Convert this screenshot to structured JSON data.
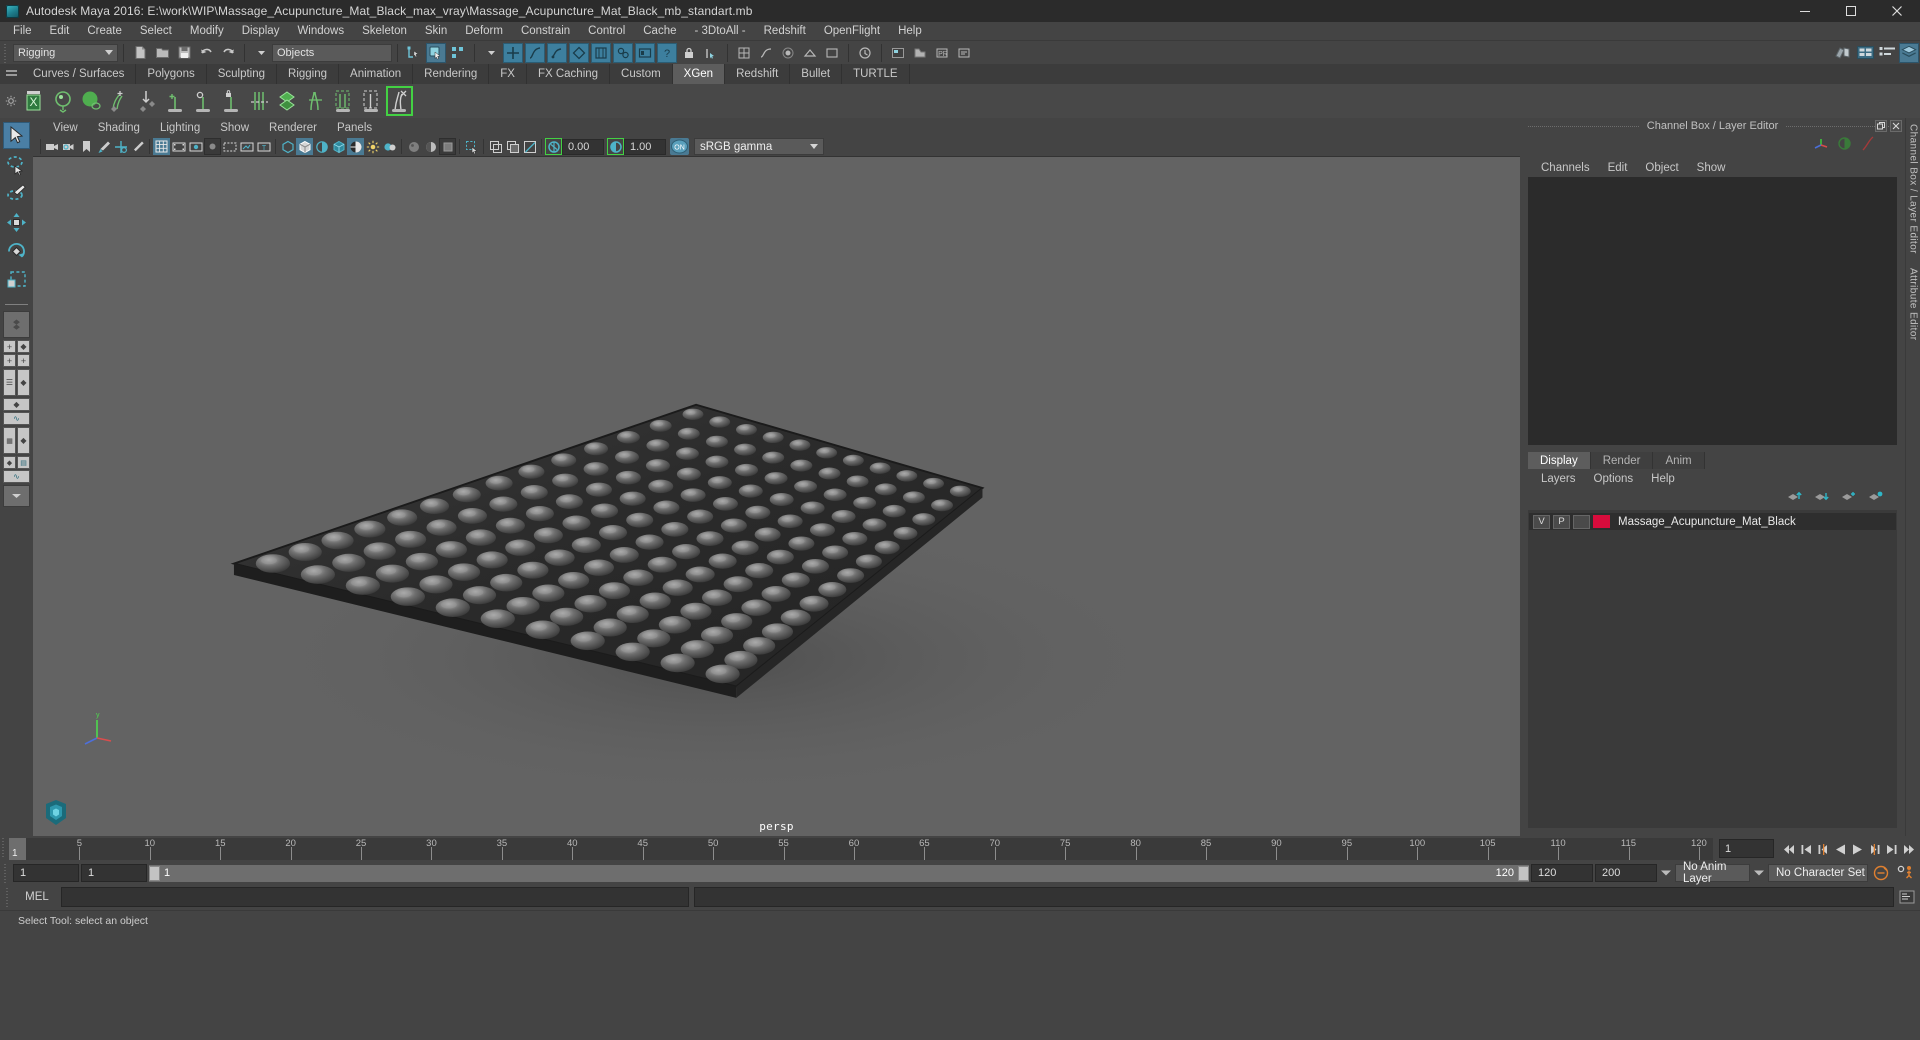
{
  "window": {
    "title": "Autodesk Maya 2016: E:\\work\\WIP\\Massage_Acupuncture_Mat_Black_max_vray\\Massage_Acupuncture_Mat_Black_mb_standart.mb",
    "app_icon": "maya-icon",
    "minimize": "minimize-icon",
    "maximize": "maximize-icon",
    "close": "close-icon"
  },
  "menubar": {
    "items": [
      {
        "label": "File"
      },
      {
        "label": "Edit"
      },
      {
        "label": "Create"
      },
      {
        "label": "Select"
      },
      {
        "label": "Modify"
      },
      {
        "label": "Display"
      },
      {
        "label": "Windows"
      },
      {
        "label": "Skeleton"
      },
      {
        "label": "Skin"
      },
      {
        "label": "Deform"
      },
      {
        "label": "Constrain"
      },
      {
        "label": "Control"
      },
      {
        "label": "Cache"
      },
      {
        "label": "- 3DtoAll -"
      },
      {
        "label": "Redshift"
      },
      {
        "label": "OpenFlight"
      },
      {
        "label": "Help"
      }
    ]
  },
  "statusline": {
    "menuset": "Rigging",
    "selection_mask": "Objects",
    "new_scene_icon": "new-scene-icon",
    "open_scene_icon": "open-scene-icon",
    "save_scene_icon": "save-scene-icon",
    "undo_icon": "undo-icon",
    "redo_icon": "redo-icon",
    "hierarchy_icon": "select-hierarchy-icon",
    "object_icon": "select-object-icon",
    "component_icon": "select-component-icon",
    "mask_icons": [
      "handle-mask-icon",
      "curve-mask-icon",
      "surface-mask-icon",
      "deform-mask-icon",
      "dynamic-mask-icon",
      "render-mask-icon",
      "misc-mask-icon",
      "lock-icon",
      "snap-curve-icon"
    ],
    "snap_icons": [
      "snap-grid-icon",
      "snap-curve-icon",
      "snap-point-icon",
      "snap-view-icon",
      "snap-projected-icon",
      "snap-live-icon",
      "construction-icon",
      "history-icon",
      "render-view-icon",
      "render-icon",
      "ipr-icon",
      "render-settings-icon",
      "hypershade-icon"
    ],
    "right_icons": [
      "show-hide-ui-icon",
      "channel-box-icon",
      "attribute-editor-icon",
      "layer-editor-icon"
    ]
  },
  "shelf": {
    "tabs": [
      {
        "label": "Curves / Surfaces",
        "active": false
      },
      {
        "label": "Polygons",
        "active": false
      },
      {
        "label": "Sculpting",
        "active": false
      },
      {
        "label": "Rigging",
        "active": false
      },
      {
        "label": "Animation",
        "active": false
      },
      {
        "label": "Rendering",
        "active": false
      },
      {
        "label": "FX",
        "active": false
      },
      {
        "label": "FX Caching",
        "active": false
      },
      {
        "label": "Custom",
        "active": false
      },
      {
        "label": "XGen",
        "active": true
      },
      {
        "label": "Redshift",
        "active": false
      },
      {
        "label": "Bullet",
        "active": false
      },
      {
        "label": "TURTLE",
        "active": false
      }
    ],
    "buttons": [
      {
        "name": "xgen-editor-icon"
      },
      {
        "name": "xgen-preview-icon"
      },
      {
        "name": "xgen-sphere-icon"
      },
      {
        "name": "xgen-add-groom-icon"
      },
      {
        "name": "xgen-density-icon"
      },
      {
        "name": "xgen-add-guide-icon"
      },
      {
        "name": "xgen-region-icon"
      },
      {
        "name": "xgen-lock-icon"
      },
      {
        "name": "xgen-cut-icon"
      },
      {
        "name": "xgen-patch-icon"
      },
      {
        "name": "xgen-bind-icon"
      },
      {
        "name": "xgen-select-guides-icon"
      },
      {
        "name": "xgen-select-patches-icon"
      },
      {
        "name": "xgen-convert-icon",
        "selected": true
      }
    ]
  },
  "toolbox": {
    "items": [
      {
        "name": "select-tool",
        "active": true
      },
      {
        "name": "lasso-select-tool",
        "active": false
      },
      {
        "name": "paint-select-tool",
        "active": false
      },
      {
        "name": "move-tool",
        "active": false
      },
      {
        "name": "rotate-tool",
        "active": false
      },
      {
        "name": "scale-tool",
        "active": false
      }
    ],
    "layouts": [
      {
        "name": "single-pane-layout"
      },
      {
        "name": "four-pane-layout"
      },
      {
        "name": "outliner-persp-layout"
      },
      {
        "name": "persp-graph-layout"
      },
      {
        "name": "hypershade-persp-layout"
      },
      {
        "name": "persp-outliner-graph-layout"
      },
      {
        "name": "more-layouts"
      }
    ]
  },
  "viewport": {
    "menus": [
      {
        "label": "View"
      },
      {
        "label": "Shading"
      },
      {
        "label": "Lighting"
      },
      {
        "label": "Show"
      },
      {
        "label": "Renderer"
      },
      {
        "label": "Panels"
      }
    ],
    "toolbar_icons": [
      "select-camera-icon",
      "camera-attributes-icon",
      "bookmark-icon",
      "image-plane-icon",
      "two-d-pan-zoom-icon",
      "grease-pencil-icon",
      "grid-icon",
      "film-gate-icon",
      "resolution-gate-icon",
      "gate-mask-icon",
      "field-chart-icon",
      "safe-action-icon",
      "safe-title-icon",
      "wireframe-icon",
      "smooth-shade-all-icon",
      "smooth-shade-selected-icon",
      "flat-shade-icon",
      "wireframe-on-shaded-icon",
      "use-default-material-icon",
      "shaded-wireframe-icon",
      "textured-icon",
      "lights-icon",
      "shadows-icon",
      "screen-space-ao-icon",
      "motion-blur-icon",
      "multisample-icon",
      "isolate-select-icon",
      "xray-icon",
      "xray-joints-icon",
      "xray-active-components-icon"
    ],
    "exposure_value": "0.00",
    "gamma_value": "1.00",
    "view_transform": "sRGB gamma",
    "exposure_icon": "exposure-icon",
    "gamma_icon": "gamma-icon",
    "color_management_toggle": "ON",
    "camera_label": "persp",
    "axis_gizmo": "axis-gizmo",
    "logo": "maya-logo"
  },
  "channel_box": {
    "panel_title": "Channel Box / Layer Editor",
    "float_icon": "undock-icon",
    "close_icon": "close-icon",
    "header_icons": [
      "manipulator-icon",
      "speed-icon",
      "curve-icon"
    ],
    "menus": [
      {
        "label": "Channels"
      },
      {
        "label": "Edit"
      },
      {
        "label": "Object"
      },
      {
        "label": "Show"
      }
    ],
    "channels": []
  },
  "layer_editor": {
    "tabs": [
      {
        "label": "Display",
        "active": true
      },
      {
        "label": "Render",
        "active": false
      },
      {
        "label": "Anim",
        "active": false
      }
    ],
    "menus": [
      {
        "label": "Layers"
      },
      {
        "label": "Options"
      },
      {
        "label": "Help"
      }
    ],
    "tool_icons": [
      "move-layer-up-icon",
      "move-layer-down-icon",
      "new-layer-icon",
      "new-layer-from-selected-icon"
    ],
    "layers": [
      {
        "visibility": "V",
        "playback": "P",
        "type": "",
        "color": "#d80c3c",
        "name": "Massage_Acupuncture_Mat_Black"
      }
    ]
  },
  "right_dock": {
    "labels": [
      "Channel Box / Layer Editor",
      "Attribute Editor"
    ]
  },
  "timeline": {
    "ticks": [
      5,
      10,
      15,
      20,
      25,
      30,
      35,
      40,
      45,
      50,
      55,
      60,
      65,
      70,
      75,
      80,
      85,
      90,
      95,
      100,
      105,
      110,
      115,
      120
    ],
    "current_frame": "1",
    "current_frame_field": "1",
    "playback_icons": [
      "go-to-start-icon",
      "step-back-keyframe-icon",
      "step-back-frame-icon",
      "play-backwards-icon",
      "play-forwards-icon",
      "step-forward-frame-icon",
      "step-forward-keyframe-icon",
      "go-to-end-icon"
    ]
  },
  "range_slider": {
    "anim_start": "1",
    "range_start": "1",
    "slider_start_label": "1",
    "slider_end_label": "120",
    "range_end": "120",
    "anim_end": "200",
    "anim_layer": "No Anim Layer",
    "character_set": "No Character Set",
    "auto_key_icon": "auto-keyframe-icon",
    "anim_prefs_icon": "animation-preferences-icon"
  },
  "command_line": {
    "language": "MEL",
    "input_value": "",
    "output_value": "",
    "script_editor_icon": "script-editor-icon"
  },
  "help_line": {
    "text": "Select Tool: select an object"
  },
  "colors": {
    "window_bg": "#444444",
    "titlebar_bg": "#2b2b2b",
    "viewport_bg": "#636363",
    "accent_blue": "#4a7a93",
    "shelf_selected": "#43d143",
    "layer_color": "#d80c3c",
    "mat_base": "#2a2a2a"
  }
}
